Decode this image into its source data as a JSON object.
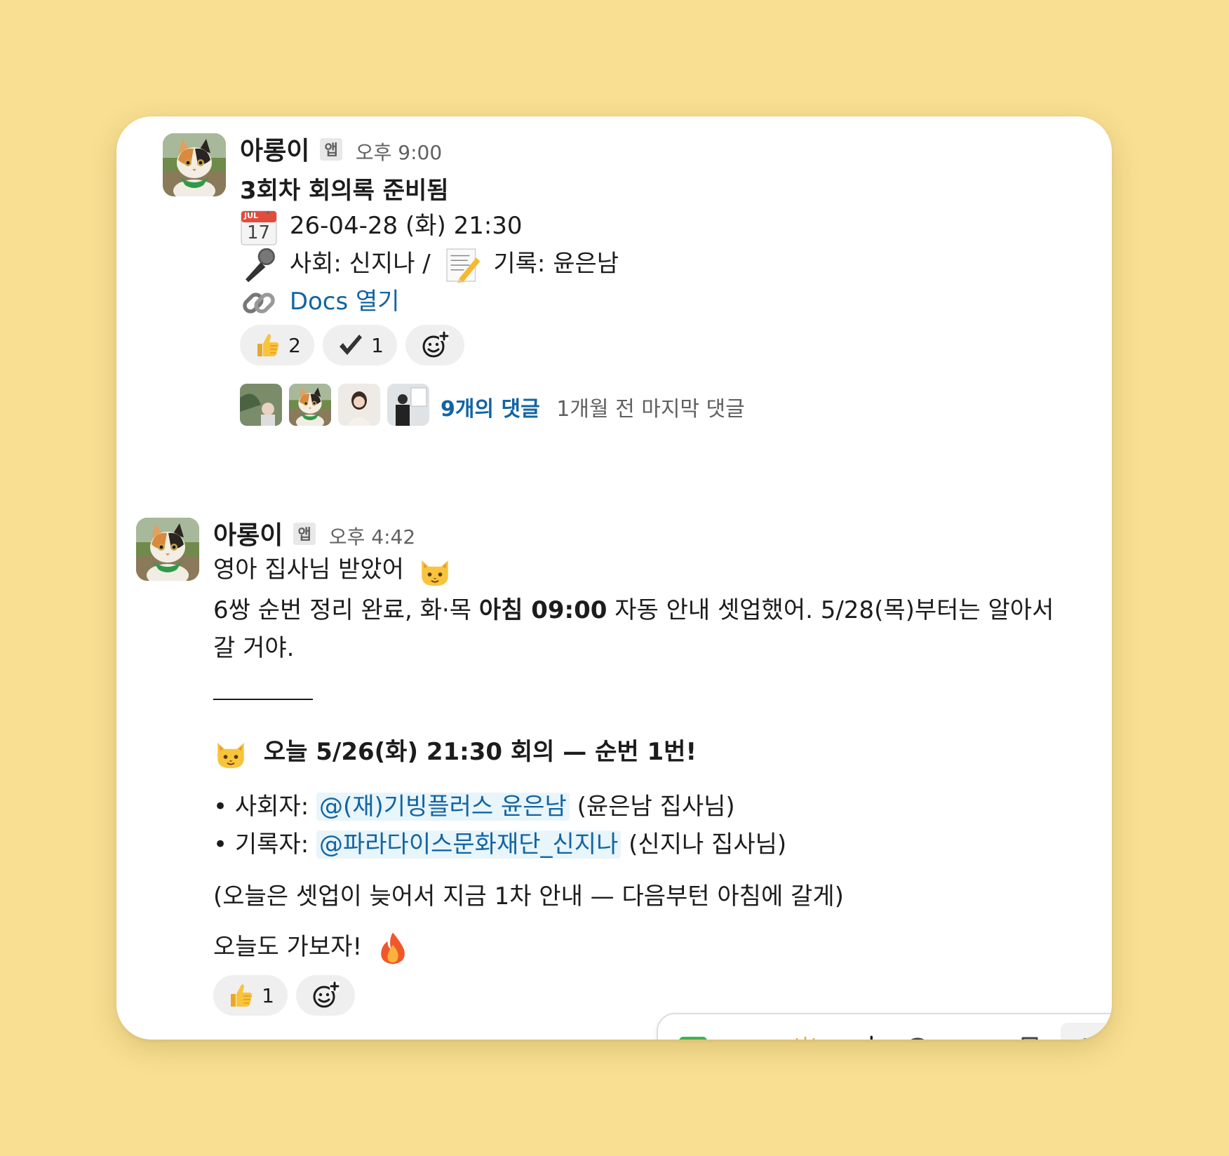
{
  "messages": [
    {
      "sender": "아롱이",
      "badge": "앱",
      "time": "오후 9:00",
      "title": "3회차 회의록 준비됨",
      "calendar_emoji": {
        "month": "JUL",
        "day": "17"
      },
      "date_line": "26-04-28 (화) 21:30",
      "roles_a": "사회: 신지나 /",
      "roles_b": "기록: 윤은남",
      "link_text": "Docs 열기",
      "reactions": [
        {
          "icon": "thumbs-up",
          "count": "2"
        },
        {
          "icon": "check-mark",
          "count": "1"
        }
      ],
      "thread": {
        "replies": "9개의 댓글",
        "last_reply": "1개월 전 마지막 댓글"
      }
    },
    {
      "sender": "아롱이",
      "badge": "앱",
      "time": "오후 4:42",
      "line1": "영아 집사님 받았어",
      "line2_pre": "6쌍 순번 정리 완료, 화·목 ",
      "line2_bold": "아침 09:00",
      "line2_post": " 자동 안내 셋업했어. 5/28(목)부터는 알아서",
      "line3": "갈 거야.",
      "heading": "오늘 5/26(화) 21:30 회의 — 순번 1번!",
      "bullets": [
        {
          "label": "사회자: ",
          "mention": "@(재)기빙플러스 윤은남",
          "suffix": " (윤은남 집사님)"
        },
        {
          "label": "기록자: ",
          "mention": "@파라다이스문화재단_신지나",
          "suffix": " (신지나 집사님)"
        }
      ],
      "note": "(오늘은 셋업이 늦어서 지금 1차 안내 — 다음부턴 아침에 갈게)",
      "closing": "오늘도 가보자!",
      "reactions": [
        {
          "icon": "thumbs-up",
          "count": "1"
        }
      ]
    }
  ],
  "hover_toolbar": [
    "check-mark-button-icon",
    "eyes-icon",
    "raising-hands-icon",
    "add-reaction-icon",
    "reply-icon",
    "share-icon",
    "bookmark-icon",
    "more-actions-icon"
  ]
}
